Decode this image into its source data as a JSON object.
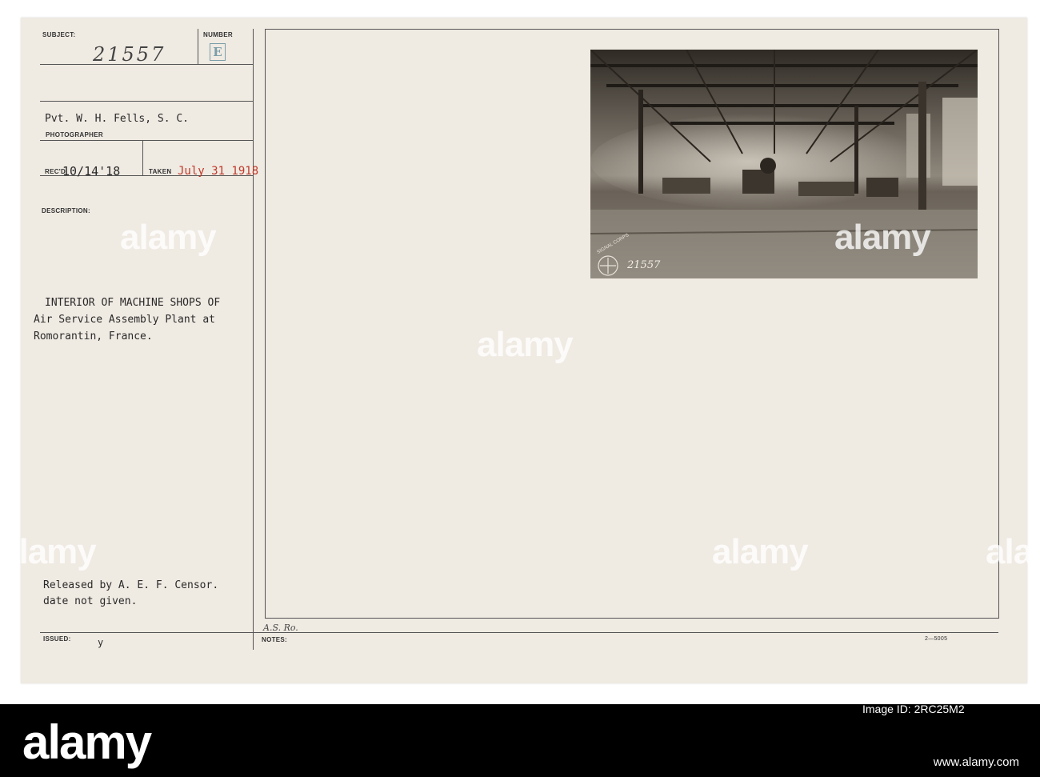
{
  "card": {
    "subject_label": "SUBJECT:",
    "subject_value": "21557",
    "number_label": "NUMBER",
    "number_value": "E",
    "photographer_name": "Pvt. W. H. Fells, S. C.",
    "photographer_label": "PHOTOGRAPHER",
    "rec_label": "REC'D",
    "rec_value": "10/14'18",
    "taken_label": "TAKEN",
    "taken_value": "July 31 1918",
    "description_label": "DESCRIPTION:",
    "description_lines": [
      "INTERIOR OF MACHINE SHOPS OF",
      "Air Service Assembly Plant at",
      "Romorantin, France."
    ],
    "released_lines": [
      "Released by A. E. F. Censor.",
      "date not given."
    ],
    "issued_label": "ISSUED:",
    "issued_value": "y",
    "notes_handwritten": "A.S. Ro.",
    "notes_label": "NOTES:",
    "form_code": "2—5005"
  },
  "photo": {
    "stamp_text": "SIGNAL CORPS",
    "photo_number": "21557"
  },
  "watermarks": [
    "alamy",
    "alamy",
    "alamy",
    "alamy",
    "alamy",
    "alamy"
  ],
  "footer": {
    "logo": "alamy",
    "image_id_label": "Image ID: 2RC25M2",
    "url": "www.alamy.com"
  },
  "colors": {
    "card": "#efeae2",
    "date_red": "#c0392b",
    "stamp_blue": "#7a9eaa",
    "footer": "#000000"
  }
}
